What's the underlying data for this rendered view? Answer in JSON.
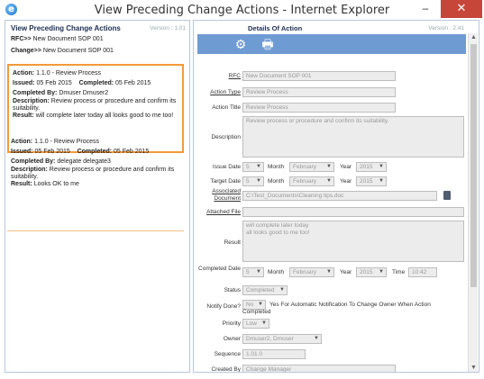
{
  "window": {
    "title": "View Preceding Change Actions - Internet Explorer",
    "minimize": "–",
    "close": "✕"
  },
  "left": {
    "heading": "View Preceding Change Actions",
    "version": "Version : 1.01",
    "rfc_label": "RFC>>",
    "rfc_value": "New Document SOP 001",
    "change_label": "Change>>",
    "change_value": "New Document SOP 001",
    "cards": [
      {
        "action_label": "Action:",
        "action": "1.1.0 - Review Process",
        "issued_label": "Issued:",
        "issued": "05 Feb 2015",
        "completed_label": "Completed:",
        "completed": "05 Feb 2015",
        "by_label": "Completed By:",
        "by": "Dmuser Dmuser2",
        "desc_label": "Description:",
        "desc": "Review process or procedure and confirm its suitability.",
        "result_label": "Result:",
        "result": "will complete later today all looks good to me too!"
      },
      {
        "action_label": "Action:",
        "action": "1.1.0 - Review Process",
        "issued_label": "Issued:",
        "issued": "05 Feb 2015",
        "completed_label": "Completed:",
        "completed": "05 Feb 2015",
        "by_label": "Completed By:",
        "by": "delegate delegate3",
        "desc_label": "Description:",
        "desc": "Review process or procedure and confirm its suitability.",
        "result_label": "Result:",
        "result": "Looks OK to me"
      }
    ]
  },
  "right": {
    "heading": "Details Of Action",
    "version": "Version : 2.41",
    "form": {
      "rfc_label": "RFC",
      "rfc": "New Document SOP 001",
      "action_type_label": "Action Type",
      "action_type": "Review Process",
      "action_title_label": "Action Title",
      "action_title": "Review Process",
      "description_label": "Description",
      "description": "Review process or procedure and confirm its suitability.",
      "issue_date_label": "Issue Date",
      "issue_day": "5",
      "month_label": "Month",
      "issue_month": "February",
      "year_label": "Year",
      "issue_year": "2015",
      "target_date_label": "Target Date",
      "target_day": "5",
      "target_month": "February",
      "target_year": "2015",
      "assoc_doc_label": "Associated Document",
      "assoc_doc": "C:\\Test_Documents\\Cleaning tips.doc",
      "attached_file_label": "Attached File",
      "attached_file": "",
      "result_label": "Result",
      "result_line1": "will complete later today",
      "result_line2": "all looks good to me too!",
      "completed_date_label": "Completed Date",
      "comp_day": "5",
      "comp_month": "February",
      "comp_year": "2015",
      "time_label": "Time",
      "comp_time": "10:42",
      "status_label": "Status",
      "status": "Completed",
      "notify_label": "Notify Done?",
      "notify": "No",
      "notify_note": "Yes For Automatic Notification To Change Owner When Action Completed",
      "priority_label": "Priority",
      "priority": "Low",
      "owner_label": "Owner",
      "owner": "Dmuser2, Dmuser",
      "sequence_label": "Sequence",
      "sequence": "1.01.0",
      "created_by_label": "Created By",
      "created_by": "Change Manager"
    }
  },
  "icons": {
    "settings": "gear-icon",
    "print": "printer-icon",
    "document": "document-icon",
    "app": "ie-icon"
  }
}
